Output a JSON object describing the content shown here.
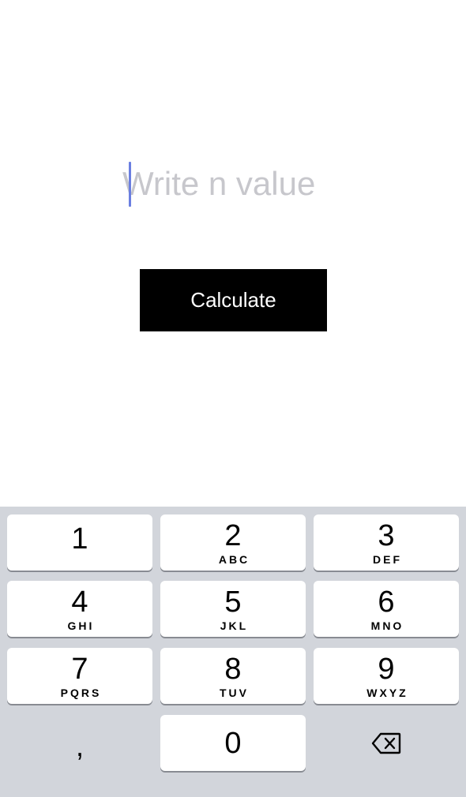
{
  "form": {
    "input_placeholder": "Write n value",
    "input_value": "",
    "button_label": "Calculate"
  },
  "keyboard": {
    "keys": [
      {
        "digit": "1",
        "letters": ""
      },
      {
        "digit": "2",
        "letters": "ABC"
      },
      {
        "digit": "3",
        "letters": "DEF"
      },
      {
        "digit": "4",
        "letters": "GHI"
      },
      {
        "digit": "5",
        "letters": "JKL"
      },
      {
        "digit": "6",
        "letters": "MNO"
      },
      {
        "digit": "7",
        "letters": "PQRS"
      },
      {
        "digit": "8",
        "letters": "TUV"
      },
      {
        "digit": "9",
        "letters": "WXYZ"
      },
      {
        "digit": "0",
        "letters": ""
      }
    ],
    "comma_label": ",",
    "backspace_icon": "backspace-icon"
  },
  "colors": {
    "keyboard_bg": "#d2d5db",
    "caret": "#6b7fe0",
    "button_bg": "#000000"
  }
}
